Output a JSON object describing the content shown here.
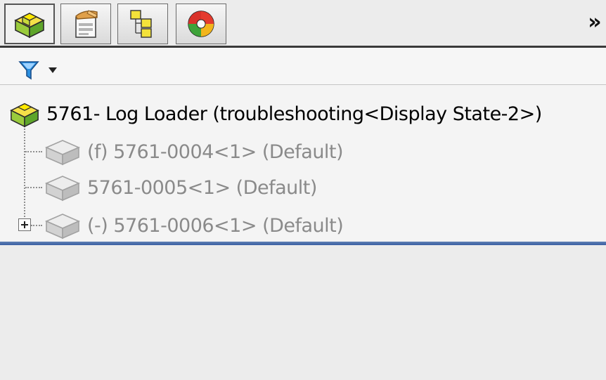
{
  "tabs": [
    {
      "name": "FeatureManager design tree",
      "icon": "assembly-tree-icon",
      "active": true
    },
    {
      "name": "PropertyManager",
      "icon": "property-manager-icon",
      "active": false
    },
    {
      "name": "ConfigurationManager",
      "icon": "configuration-manager-icon",
      "active": false
    },
    {
      "name": "DisplayManager",
      "icon": "display-manager-icon",
      "active": false
    }
  ],
  "overflow_label": "»",
  "filter": {
    "icon": "filter-icon",
    "dropdown_icon": "caret-down-icon"
  },
  "tree": {
    "root": {
      "icon": "assembly-icon",
      "label": "5761- Log Loader  (troubleshooting<Display State-2>)"
    },
    "children": [
      {
        "icon": "component-icon",
        "label": "(f) 5761-0004<1> (Default)",
        "expandable": false
      },
      {
        "icon": "component-icon",
        "label": "5761-0005<1> (Default)",
        "expandable": false
      },
      {
        "icon": "component-icon",
        "label": "(-) 5761-0006<1> (Default)",
        "expandable": true
      }
    ]
  },
  "colors": {
    "root_text": "#000000",
    "suppressed_text": "#8a8a8a",
    "separator": "#3a5fa3"
  }
}
